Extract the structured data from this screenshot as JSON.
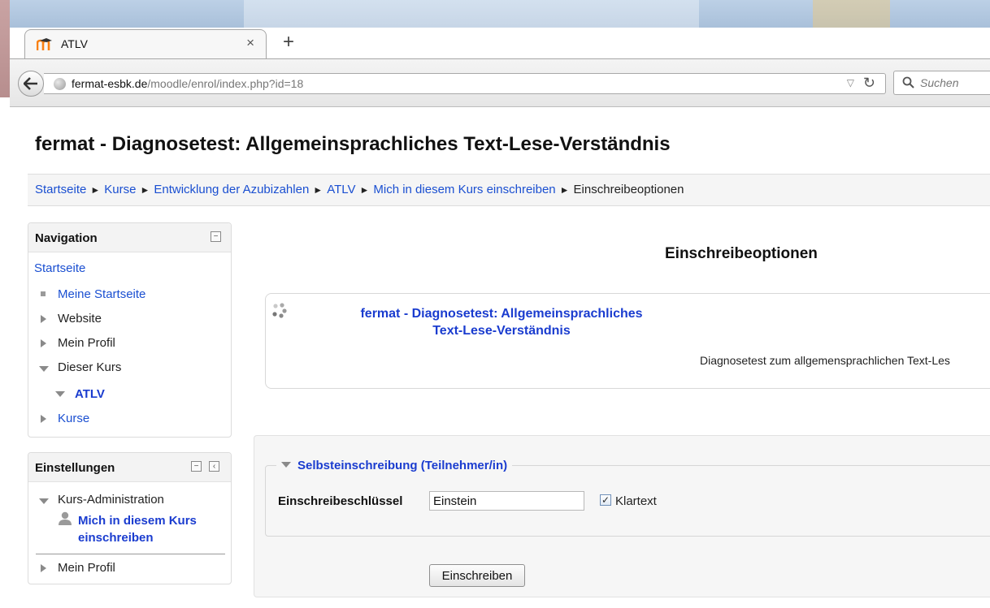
{
  "browser": {
    "tab_title": "ATLV",
    "tab_close": "×",
    "new_tab": "+",
    "url_host": "fermat-esbk.de",
    "url_path": "/moodle/enrol/index.php?id=18",
    "search_placeholder": "Suchen"
  },
  "page": {
    "heading": "fermat - Diagnosetest: Allgemeinsprachliches Text-Lese-Verständnis"
  },
  "breadcrumb": {
    "items": [
      "Startseite",
      "Kurse",
      "Entwicklung der Azubizahlen",
      "ATLV",
      "Mich in diesem Kurs einschreiben"
    ],
    "current": "Einschreibeoptionen",
    "separator": "►"
  },
  "navigation": {
    "title": "Navigation",
    "home": "Startseite",
    "items": [
      "Meine Startseite",
      "Website",
      "Mein Profil",
      "Dieser Kurs",
      "ATLV",
      "Kurse"
    ]
  },
  "settings": {
    "title": "Einstellungen",
    "course_admin": "Kurs-Administration",
    "enrol_me_line1": "Mich in diesem Kurs",
    "enrol_me_line2": "einschreiben",
    "my_profile": "Mein Profil"
  },
  "main": {
    "title": "Einschreibeoptionen",
    "course_name_line1": "fermat - Diagnosetest: Allgemeinsprachliches",
    "course_name_line2": "Text-Lese-Verständnis",
    "course_summary": "Diagnosetest zum allgemensprachlichen Text-Les",
    "self_enrol_legend": "Selbsteinschreibung (Teilnehmer/in)",
    "key_label": "Einschreibeschlüssel",
    "key_value": "Einstein",
    "unmask_label": "Klartext",
    "unmask_checked": true,
    "enrol_button": "Einschreiben"
  },
  "colors": {
    "link": "#1a4fd1",
    "moodle_orange": "#f98012"
  }
}
